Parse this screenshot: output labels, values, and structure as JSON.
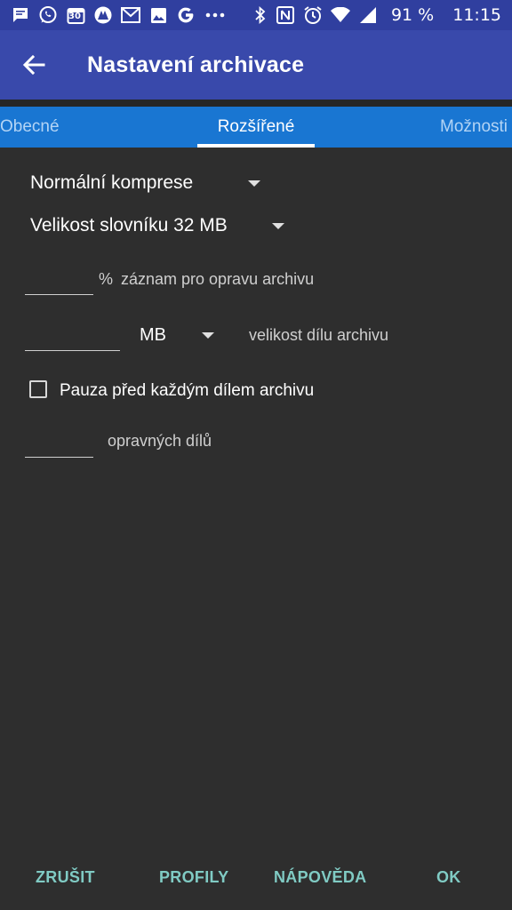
{
  "status_bar": {
    "icons": [
      "message-icon",
      "whatsapp-icon",
      "calendar-icon",
      "fitness-icon",
      "gmail-icon",
      "photos-icon",
      "google-icon",
      "more-dots-icon",
      "bluetooth-icon",
      "nfc-icon",
      "alarm-icon",
      "wifi-icon",
      "signal-icon"
    ],
    "calendar_day": "30",
    "battery": "91 %",
    "time": "11:15"
  },
  "app_bar": {
    "title": "Nastavení archivace",
    "back_icon": "arrow-back-icon"
  },
  "tabs": [
    {
      "label": "Obecné",
      "selected": false
    },
    {
      "label": "Rozšířené",
      "selected": true
    },
    {
      "label": "Možnosti",
      "selected": false
    }
  ],
  "form": {
    "compression_value": "Normální komprese",
    "dictionary_value": "Velikost slovníku 32 MB",
    "recovery_percent_value": "",
    "recovery_percent_unit": "%",
    "recovery_label": "záznam pro opravu archivu",
    "volume_size_value": "",
    "volume_unit_value": "MB",
    "volume_label": "velikost dílu archivu",
    "pause_checkbox_label": "Pauza před každým dílem archivu",
    "pause_checked": false,
    "recovery_volumes_value": "",
    "recovery_volumes_label": "opravných dílů"
  },
  "buttons": {
    "cancel": "ZRUŠIT",
    "profiles": "PROFILY",
    "help": "NÁPOVĚDA",
    "ok": "OK"
  },
  "colors": {
    "status_bar": "#303f9f",
    "app_bar": "#3949ab",
    "tab_bar": "#1976d2",
    "background": "#2e2e2e",
    "button_text": "#80cbc4"
  }
}
